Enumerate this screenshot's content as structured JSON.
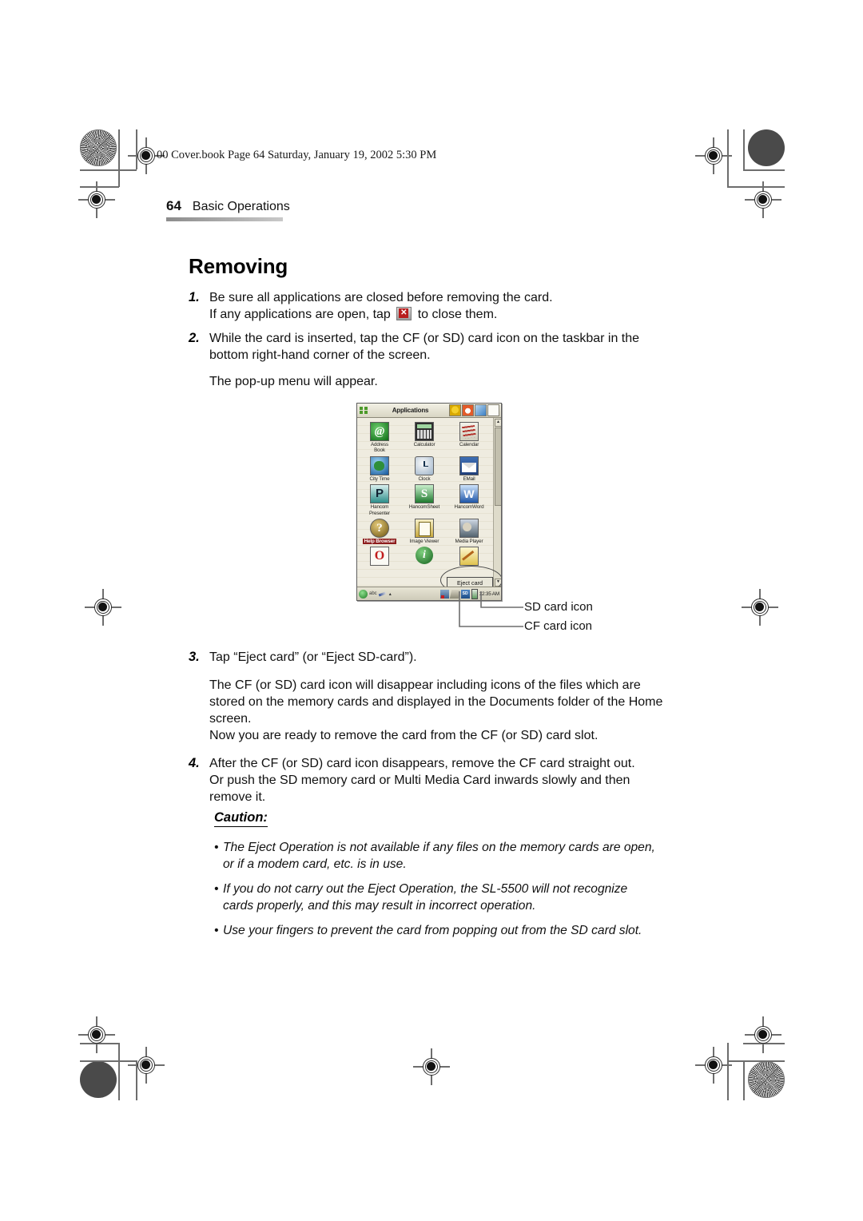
{
  "header": {
    "filename_line": "00 Cover.book  Page 64  Saturday, January 19, 2002  5:30 PM",
    "page_number": "64",
    "section": "Basic Operations"
  },
  "title": "Removing",
  "steps": [
    {
      "num": "1.",
      "line1": "Be sure all applications are closed before removing the card.",
      "line2_before": "If any applications are open, tap",
      "line2_after": "to close them.",
      "icon_glyph": "✕"
    },
    {
      "num": "2.",
      "line1": "While the card is inserted, tap the CF (or SD) card icon on the taskbar in the",
      "line2": "bottom right-hand corner of the screen.",
      "para": "The pop-up menu will appear."
    },
    {
      "num": "3.",
      "line1": "Tap “Eject card” (or “Eject SD-card”).",
      "para_lines": [
        "The CF (or SD) card icon will disappear including icons of the files which are",
        "stored on the memory cards and displayed in the Documents folder of the Home",
        "screen.",
        "Now you are ready to remove the card from the CF (or SD) card slot."
      ]
    },
    {
      "num": "4.",
      "line1": "After the CF (or SD) card icon disappears, remove the CF card straight out.",
      "line2": "Or push the SD memory card or Multi Media Card inwards slowly and then",
      "line3": "remove it."
    }
  ],
  "pda": {
    "window_title": "Applications",
    "title_buttons": [
      "smiley-button",
      "settings-button",
      "rotate-button",
      "new-doc-button"
    ],
    "scroll_up": "▲",
    "scroll_down": "▼",
    "rows": [
      [
        {
          "label": "Address\nBook",
          "icon": "address-book-icon",
          "glyph": "@"
        },
        {
          "label": "Calculator",
          "icon": "calculator-icon",
          "glyph": ""
        },
        {
          "label": "Calendar",
          "icon": "calendar-icon",
          "glyph": ""
        }
      ],
      [
        {
          "label": "City Time",
          "icon": "city-time-icon",
          "glyph": ""
        },
        {
          "label": "Clock",
          "icon": "clock-icon",
          "glyph": ""
        },
        {
          "label": "EMail",
          "icon": "email-icon",
          "glyph": ""
        }
      ],
      [
        {
          "label": "Hancom\nPresenter",
          "icon": "hancom-presenter-icon",
          "glyph": "P"
        },
        {
          "label": "HancomSheet",
          "icon": "hancom-sheet-icon",
          "glyph": "S"
        },
        {
          "label": "HancomWord",
          "icon": "hancom-word-icon",
          "glyph": "W"
        }
      ],
      [
        {
          "label": "Help Browser",
          "icon": "help-browser-icon",
          "glyph": "?",
          "highlighted": true
        },
        {
          "label": "Image Viewer",
          "icon": "image-viewer-icon",
          "glyph": ""
        },
        {
          "label": "Media Player",
          "icon": "media-player-icon",
          "glyph": ""
        }
      ],
      [
        {
          "label": "",
          "icon": "opera-icon",
          "glyph": ""
        },
        {
          "label": "",
          "icon": "info-icon",
          "glyph": "i"
        },
        {
          "label": "",
          "icon": "notes-icon",
          "glyph": ""
        }
      ]
    ],
    "eject_menu_label": "Eject card",
    "taskbar": {
      "abc_label": "abc",
      "caret": "▴",
      "sd_label": "SD",
      "time": "12:35 AM"
    }
  },
  "callouts": {
    "sd": "SD card icon",
    "cf": "CF card icon"
  },
  "caution": {
    "heading": "Caution:",
    "bullet": "•",
    "items": [
      [
        "The Eject Operation is not available if any files on the memory cards are open,",
        "or if a modem card, etc. is in use."
      ],
      [
        "If you do not carry out the Eject Operation, the SL-5500 will not recognize",
        "cards properly, and this may result in incorrect operation."
      ],
      [
        "Use your fingers to prevent the card from popping out from the SD card slot."
      ]
    ]
  }
}
